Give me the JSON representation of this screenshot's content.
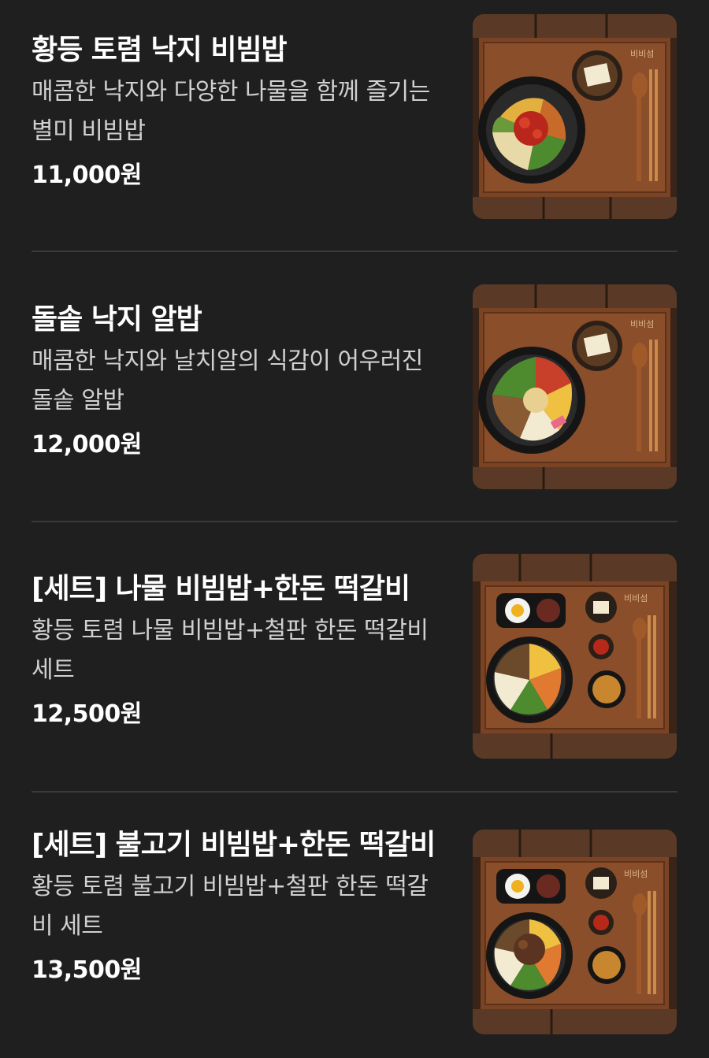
{
  "menu": {
    "items": [
      {
        "title": "황등 토렴 낙지 비빔밥",
        "description": "매콤한 낙지와 다양한 나물을 함께 즐기는 별미 비빔밥",
        "price": "11,000원",
        "image_icon": "octopus-bibimbap-image",
        "tray_logo": "비비섬"
      },
      {
        "title": "돌솥 낙지 알밥",
        "description": "매콤한 낙지와 날치알의 식감이 어우러진 돌솥 알밥",
        "price": "12,000원",
        "image_icon": "octopus-fish-roe-rice-image",
        "tray_logo": "비비섬"
      },
      {
        "title": "[세트] 나물 비빔밥+한돈 떡갈비",
        "description": "황등 토렴 나물 비빔밥+철판 한돈 떡갈비 세트",
        "price": "12,500원",
        "image_icon": "namul-bibimbap-tteokgalbi-set-image",
        "tray_logo": "비비섬"
      },
      {
        "title": "[세트] 불고기 비빔밥+한돈 떡갈비",
        "description": "황등 토렴 불고기 비빔밥+철판 한돈 떡갈비 세트",
        "price": "13,500원",
        "image_icon": "bulgogi-bibimbap-tteokgalbi-set-image",
        "tray_logo": "비비섬"
      }
    ]
  }
}
